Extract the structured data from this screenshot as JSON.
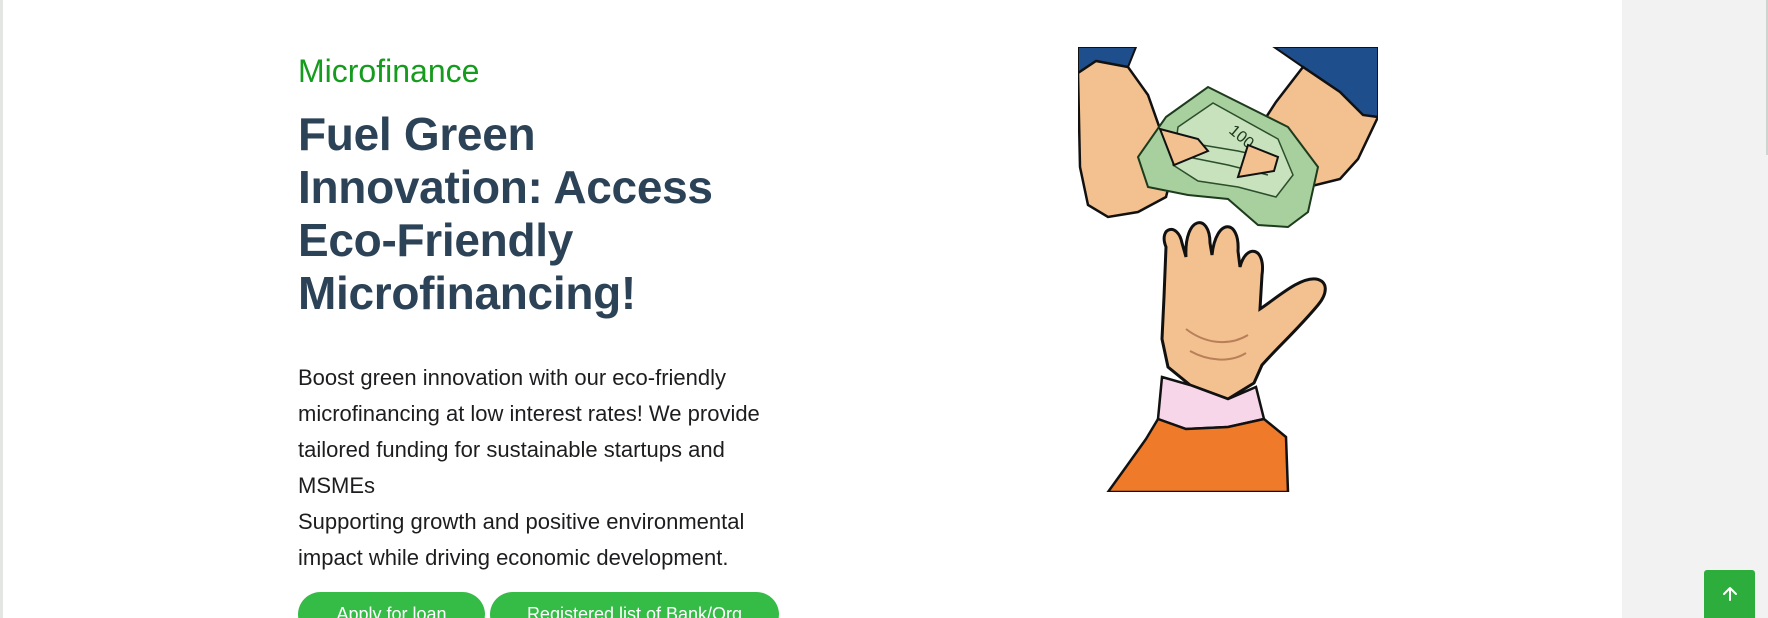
{
  "hero": {
    "eyebrow": "Microfinance",
    "headline": "Fuel Green Innovation: Access Eco-Friendly Microfinancing!",
    "description_line1": "Boost green innovation with our eco-friendly microfinancing at low interest rates! We provide tailored funding for sustainable startups and MSMEs",
    "description_line2": "Supporting growth and positive environmental impact while driving economic development.",
    "banknote_label": "100"
  },
  "buttons": {
    "apply_label": "Apply for loan",
    "list_label": "Registered list of Bank/Org"
  },
  "icons": {
    "illustration": "hands-exchanging-money-illustration",
    "scroll_top": "arrow-up-icon"
  },
  "colors": {
    "eyebrow": "#159b1d",
    "headline": "#2c4257",
    "button": "#35bc47",
    "scroll_top": "#2dad3c"
  }
}
